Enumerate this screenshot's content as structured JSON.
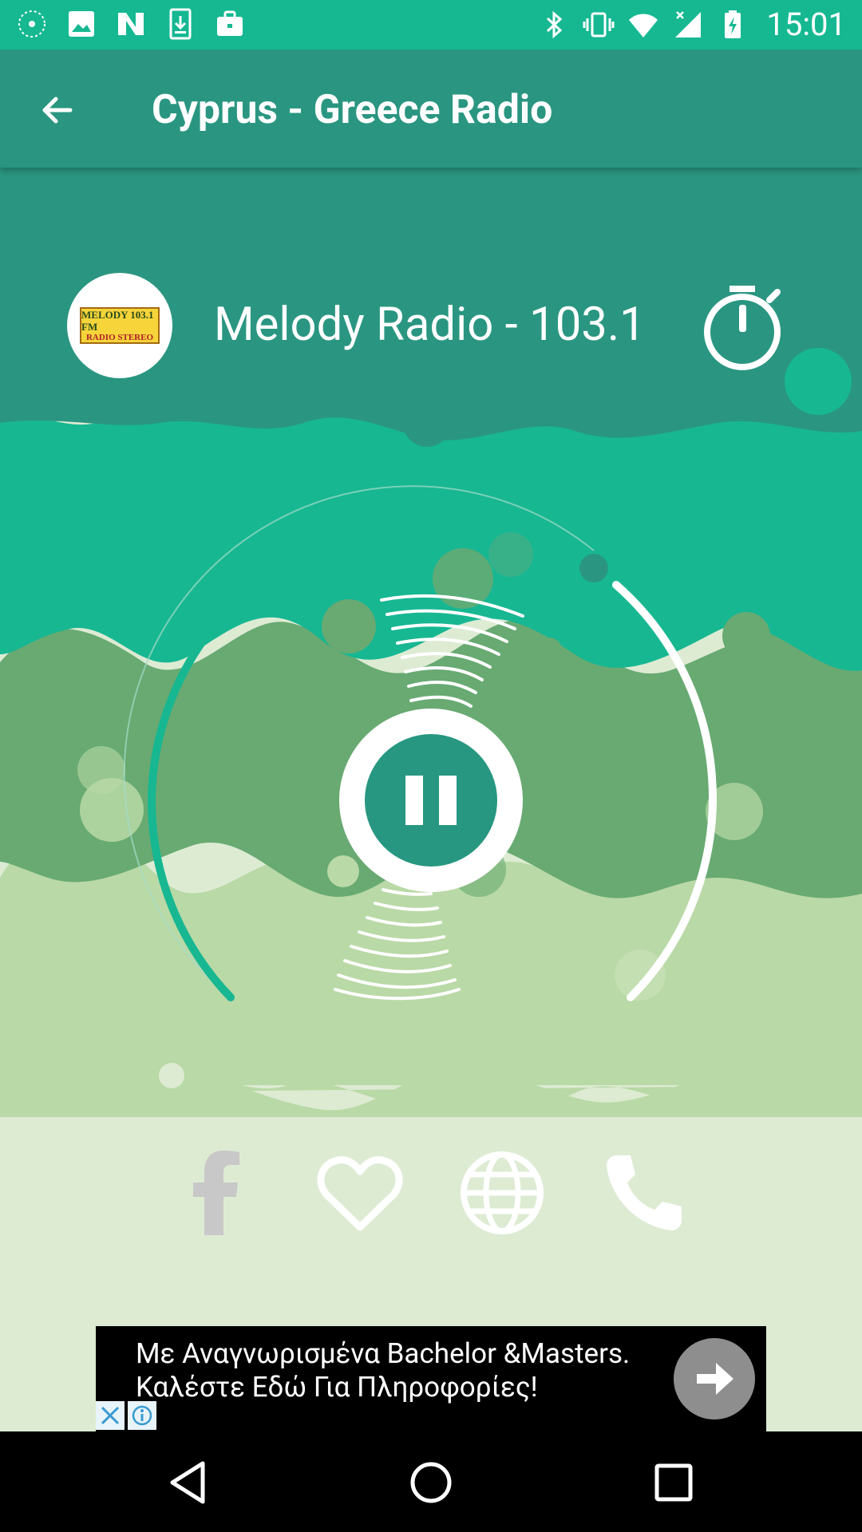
{
  "status_bar": {
    "time": "15:01",
    "left_icons": [
      "app-icon",
      "image-icon",
      "n-icon",
      "download-icon",
      "briefcase-icon"
    ],
    "right_icons": [
      "bluetooth-icon",
      "vibrate-icon",
      "wifi-icon",
      "signal-icon",
      "battery-icon"
    ]
  },
  "app_bar": {
    "title": "Cyprus - Greece Radio"
  },
  "station": {
    "name": "Melody Radio - 103.1",
    "logo_text": "MELODY 103.1 FM",
    "logo_sub": "RADIO STEREO"
  },
  "player": {
    "state": "playing"
  },
  "social": [
    "facebook-icon",
    "heart-icon",
    "globe-icon",
    "phone-icon"
  ],
  "ad": {
    "line1": "Με Αναγνωρισμένα Bachelor &Masters.",
    "line2": "Καλέστε Εδώ Για Πληροφορίες!"
  },
  "colors": {
    "status_bar": "#16b892",
    "app_bar": "#2a9681",
    "teal": "#17b792",
    "mid_green": "#68aa72",
    "light_green": "#b9d9a6",
    "pale_green": "#ddebd3"
  }
}
